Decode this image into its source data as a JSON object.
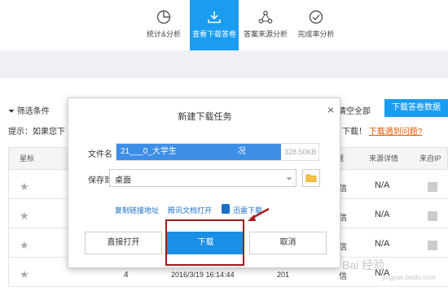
{
  "nav": {
    "tabs": [
      {
        "label": "统计&分析",
        "icon": "pie-chart-icon"
      },
      {
        "label": "查看下载答卷",
        "icon": "download-icon",
        "active": true
      },
      {
        "label": "答案来源分析",
        "icon": "source-network-icon"
      },
      {
        "label": "完成率分析",
        "icon": "check-circle-icon"
      }
    ]
  },
  "toolbar": {
    "filter_label": "筛选条件",
    "clear_all": "清空全部",
    "download_data": "下载答卷数据"
  },
  "hint": {
    "prefix": "提示：如果您下",
    "suffix": "下载！",
    "problem_link": "下载遇到问题?"
  },
  "table": {
    "headers": [
      "星标",
      "题",
      "来源详情",
      "来自IP"
    ],
    "rows": [
      {
        "na": "N/A",
        "tag": "信"
      },
      {
        "na": "N/A",
        "tag": "信"
      },
      {
        "na": "N/A",
        "tag": "信"
      },
      {
        "na": "N/A",
        "tag": "信",
        "seq": "4",
        "date": "2016/3/19 16:14:44",
        "num": "201"
      }
    ]
  },
  "modal": {
    "title": "新建下载任务",
    "filename_label": "文件名",
    "filename_value": "21___0_大学生",
    "filename_suffix": "况",
    "file_size": "328.50KB",
    "save_label": "保存到",
    "save_value": "桌面",
    "link_copy": "复制链接地址",
    "link_tencent": "腾讯文档打开",
    "link_thunder": "迅雷下载",
    "btn_open": "直接打开",
    "btn_download": "下载",
    "btn_cancel": "取消"
  },
  "watermark": {
    "main": "Bai 经验",
    "sub": "jingyan.baidu.com"
  },
  "colors": {
    "accent": "#1a9cf0",
    "highlight_frame": "#9e1b1b",
    "link": "#1b6fc8",
    "warn_link": "#e85a00"
  }
}
